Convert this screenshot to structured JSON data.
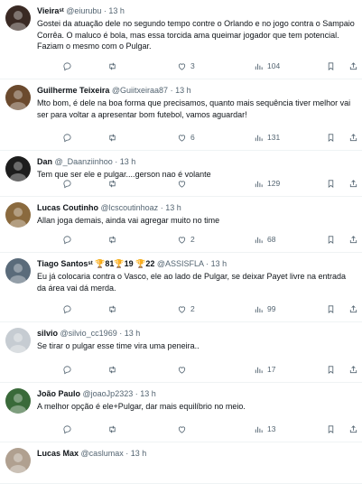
{
  "tweets": [
    {
      "name": "Vieira",
      "name_suffix": "ˢᵗ",
      "handle": "@eiurubu",
      "time": "13 h",
      "text": "Gostei da atuação dele no segundo tempo contre o Orlando e no jogo contra o Sampaio Corrêa. O maluco é bola, mas essa torcida ama queimar jogador que tem potencial. Faziam o mesmo com o Pulgar.",
      "replies": "",
      "retweets": "",
      "likes": "3",
      "views": "104",
      "avatar_color": "#3a2a24"
    },
    {
      "name": "Guilherme Teixeira",
      "name_suffix": "",
      "handle": "@Guiitxeiraa87",
      "time": "13 h",
      "text": "Mto bom, é dele na boa forma que precisamos, quanto mais sequência tiver melhor vai ser para voltar a apresentar bom futebol, vamos aguardar!",
      "replies": "",
      "retweets": "",
      "likes": "6",
      "views": "131",
      "avatar_color": "#6b4a2e"
    },
    {
      "name": "Dan",
      "name_suffix": "",
      "handle": "@_Daanziinhoo",
      "time": "13 h",
      "text": "Tem que ser ele e pulgar....gerson nao é volante",
      "replies": "",
      "retweets": "",
      "likes": "",
      "views": "129",
      "avatar_color": "#1d1d1d"
    },
    {
      "name": "Lucas Coutinho",
      "name_suffix": "",
      "handle": "@lcscoutinhoaz",
      "time": "13 h",
      "text": "Allan joga demais, ainda vai agregar muito no time",
      "replies": "",
      "retweets": "",
      "likes": "2",
      "views": "68",
      "avatar_color": "#8a6a3e"
    },
    {
      "name": "Tiago Santos",
      "name_suffix": "ˢᵗ 🏆81🏆19 🏆22",
      "handle": "@ASSISFLA",
      "time": "13 h",
      "text": "Eu já colocaria contra o Vasco, ele ao lado de Pulgar, se deixar Payet livre na entrada da área vai dá merda.",
      "replies": "",
      "retweets": "",
      "likes": "2",
      "views": "99",
      "avatar_color": "#5a6b7a"
    },
    {
      "name": "silvio",
      "name_suffix": "",
      "handle": "@silvio_cc1969",
      "time": "13 h",
      "text": "Se tirar o pulgar esse time vira uma peneira..",
      "replies": "",
      "retweets": "",
      "likes": "",
      "views": "17",
      "avatar_color": "#c6ccd2"
    },
    {
      "name": "João Paulo",
      "name_suffix": "",
      "handle": "@joaoJp2323",
      "time": "13 h",
      "text": "A melhor opção é ele+Pulgar, dar mais equilíbrio no meio.",
      "replies": "",
      "retweets": "",
      "likes": "",
      "views": "13",
      "avatar_color": "#3a6a3a"
    },
    {
      "name": "Lucas Max",
      "name_suffix": "",
      "handle": "@caslumax",
      "time": "13 h",
      "text": "",
      "replies": "",
      "retweets": "",
      "likes": "",
      "views": "",
      "avatar_color": "#b0a090"
    }
  ]
}
